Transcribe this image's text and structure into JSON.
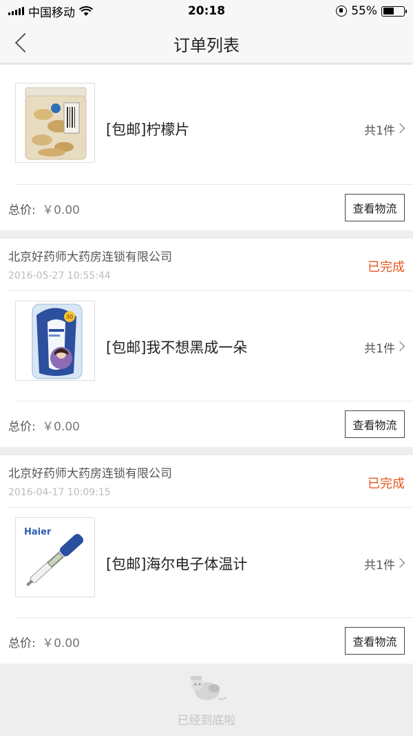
{
  "status_bar": {
    "carrier": "中国移动",
    "time": "20:18",
    "battery": "55%",
    "battery_level": 0.55
  },
  "nav": {
    "title": "订单列表"
  },
  "orders": [
    {
      "item": {
        "name": "[包邮]柠檬片",
        "count": "共1件",
        "thumb_icon": "lemon-slices-jar"
      },
      "total_label": "总价:",
      "total_value": "￥0.00",
      "logistics_button": "查看物流"
    },
    {
      "store": "北京好药师大药房连锁有限公司",
      "time": "2016-05-27 10:55:44",
      "status": "已完成",
      "item": {
        "name": "[包邮]我不想黑成一朵",
        "count": "共1件",
        "thumb_icon": "sunscreen-bottle"
      },
      "total_label": "总价:",
      "total_value": "￥0.00",
      "logistics_button": "查看物流"
    },
    {
      "store": "北京好药师大药房连锁有限公司",
      "time": "2016-04-17 10:09:15",
      "status": "已完成",
      "item": {
        "name": "[包邮]海尔电子体温计",
        "count": "共1件",
        "thumb_icon": "digital-thermometer",
        "thumb_brand": "Haier"
      },
      "total_label": "总价:",
      "total_value": "￥0.00",
      "logistics_button": "查看物流"
    }
  ],
  "end_of_list": "已经到底啦",
  "colors": {
    "status_orange": "#e8541e",
    "page_bg": "#eeeeee"
  }
}
